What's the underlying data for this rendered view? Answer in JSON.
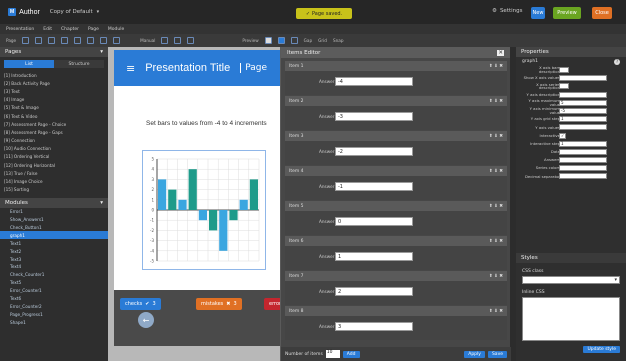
{
  "app": {
    "logo_mark": "M",
    "logo_text": "Author",
    "project": "Copy of Default",
    "saved": "Page saved.",
    "settings": "Settings",
    "btn_new": "New",
    "btn_preview": "Preview",
    "btn_close": "Close"
  },
  "menu": [
    "Presentation",
    "Edit",
    "Chapter",
    "Page",
    "Module"
  ],
  "toolbar": [
    "Page",
    "Manual",
    "Preview",
    "Gap",
    "Grid",
    "Snap"
  ],
  "pages": {
    "title": "Pages",
    "tabs": [
      "List",
      "Structure"
    ],
    "items": [
      "[1] Introduction",
      "[2] Back Activity Page",
      "[3] Text",
      "[4] Image",
      "[5] Text & Image",
      "[6] Text & Video",
      "[7] Assessment Page - Choice",
      "[8] Assessment Page - Gaps",
      "[9] Connection",
      "[10] Audio Connection",
      "[11] Ordering Vertical",
      "[12] Ordering Horizontal",
      "[13] True / False",
      "[14] Image Choice",
      "[15] Sorting"
    ]
  },
  "modules": {
    "title": "Modules",
    "items": [
      "Error1",
      "Show_Answers1",
      "Check_Button1",
      "graph1",
      "Text1",
      "Text2",
      "Text3",
      "Text4",
      "Check_Counter1",
      "Text5",
      "Error_Counter1",
      "Text6",
      "Error_Counter2",
      "Page_Progress1",
      "Shape1"
    ],
    "selected": 3
  },
  "slide": {
    "menu_icon": "≡",
    "title": "Presentation Title",
    "page": "Page",
    "prompt": "Set bars to values from -4 to 4 increments"
  },
  "chart_data": {
    "type": "bar",
    "values": [
      3,
      2,
      1,
      4,
      -1,
      -2,
      -4,
      -1,
      1,
      3
    ],
    "ylim": [
      -5,
      5
    ],
    "grid": true,
    "title": "",
    "xlabel": "",
    "ylabel": ""
  },
  "score": {
    "checks_label": "checks",
    "checks": "3",
    "mistakes_label": "mistakes",
    "mistakes": "3",
    "errors_label": "errors"
  },
  "editor": {
    "title": "Items Editor",
    "value_label": "Answer",
    "items": [
      {
        "name": "Item 1",
        "value": "-4"
      },
      {
        "name": "Item 2",
        "value": "-3"
      },
      {
        "name": "Item 3",
        "value": "-2"
      },
      {
        "name": "Item 4",
        "value": "-1"
      },
      {
        "name": "Item 5",
        "value": "0"
      },
      {
        "name": "Item 6",
        "value": "1"
      },
      {
        "name": "Item 7",
        "value": "2"
      },
      {
        "name": "Item 8",
        "value": "3"
      }
    ],
    "footer_label": "Number of items",
    "count": "10",
    "add": "Add",
    "apply": "Apply",
    "save": "Save"
  },
  "properties": {
    "title": "Properties",
    "module": "graph1",
    "rows": [
      {
        "k": "X axis bars description",
        "v": ""
      },
      {
        "k": "Show X axis values",
        "v": ""
      },
      {
        "k": "X axis series description",
        "v": ""
      },
      {
        "k": "Y axis description",
        "v": ""
      },
      {
        "k": "Y axis maximum value",
        "v": "5"
      },
      {
        "k": "Y axis minimum value",
        "v": "-5"
      },
      {
        "k": "Y axis grid step",
        "v": "1"
      },
      {
        "k": "Y axis values",
        "v": ""
      },
      {
        "k": "Interactive",
        "v": "✓"
      },
      {
        "k": "Interactive step",
        "v": "1"
      },
      {
        "k": "Data",
        "v": ""
      },
      {
        "k": "Answers",
        "v": ""
      },
      {
        "k": "Series colors",
        "v": ""
      },
      {
        "k": "Decimal separator",
        "v": ""
      }
    ],
    "styles_title": "Styles",
    "css_class": "CSS class",
    "inline_css": "Inline CSS",
    "update": "Update style"
  }
}
